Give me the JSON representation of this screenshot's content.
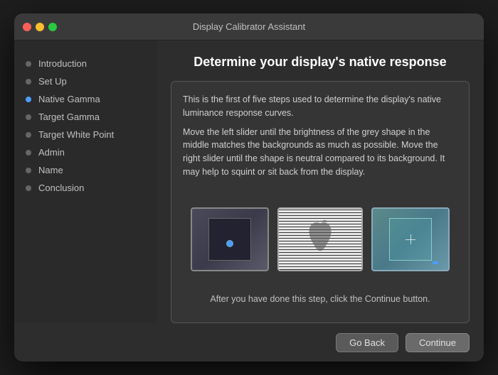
{
  "window": {
    "title": "Display Calibrator Assistant"
  },
  "header": {
    "title": "Determine your display's native response"
  },
  "sidebar": {
    "items": [
      {
        "label": "Introduction",
        "state": "inactive"
      },
      {
        "label": "Set Up",
        "state": "inactive"
      },
      {
        "label": "Native Gamma",
        "state": "active"
      },
      {
        "label": "Target Gamma",
        "state": "inactive"
      },
      {
        "label": "Target White Point",
        "state": "inactive"
      },
      {
        "label": "Admin",
        "state": "inactive"
      },
      {
        "label": "Name",
        "state": "inactive"
      },
      {
        "label": "Conclusion",
        "state": "inactive"
      }
    ]
  },
  "content": {
    "paragraph1": "This is the first of five steps used to determine the display's native luminance response curves.",
    "paragraph2": "Move the left slider until the brightness of the grey shape in the middle matches the backgrounds as much as possible. Move the right slider until the shape is neutral compared to its background. It may help to squint or sit back from the display.",
    "after_text": "After you have done this step, click the Continue button."
  },
  "buttons": {
    "go_back": "Go Back",
    "continue": "Continue"
  }
}
